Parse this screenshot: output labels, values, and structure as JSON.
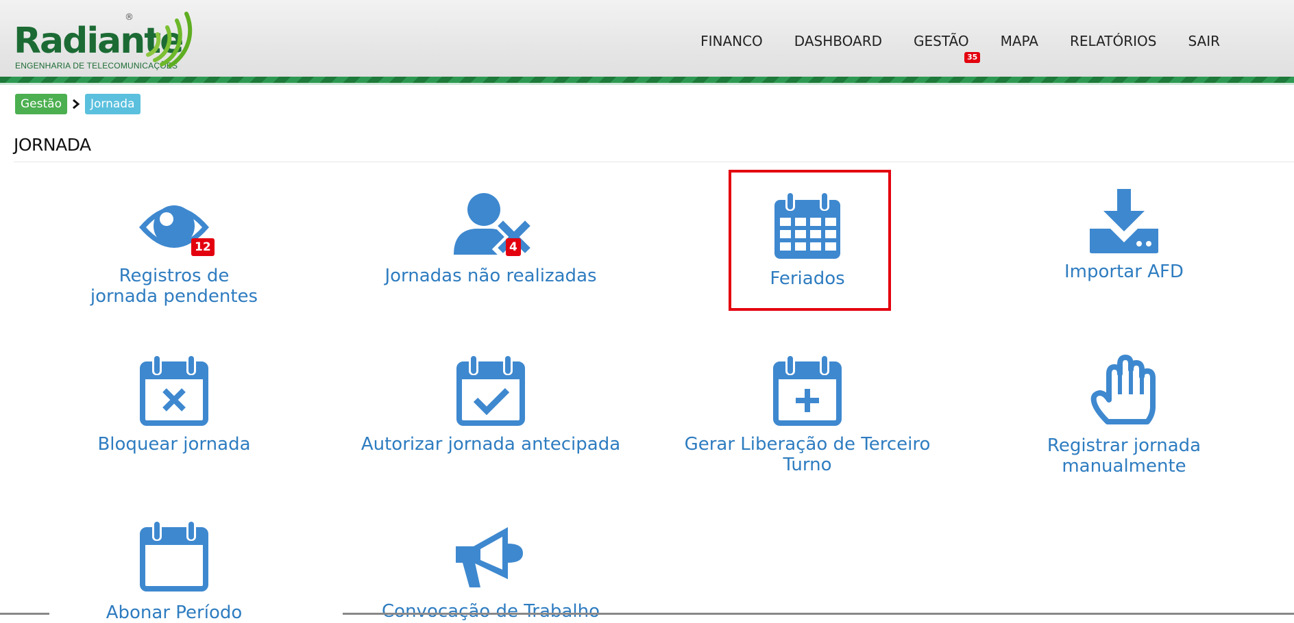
{
  "logo": {
    "name": "Radiante",
    "subtitle": "ENGENHARIA DE TELECOMUNICAÇÕES",
    "registered": "®"
  },
  "nav": {
    "items": [
      {
        "label": "FINANCO"
      },
      {
        "label": "DASHBOARD"
      },
      {
        "label": "GESTÃO",
        "badge": "35"
      },
      {
        "label": "MAPA"
      },
      {
        "label": "RELATÓRIOS"
      },
      {
        "label": "SAIR"
      }
    ]
  },
  "breadcrumb": [
    "Gestão",
    "Jornada"
  ],
  "page": {
    "title": "JORNADA"
  },
  "tiles": [
    {
      "label": "Registros de jornada pendentes",
      "icon": "eye-icon",
      "badge": "12"
    },
    {
      "label": "Jornadas não realizadas",
      "icon": "user-times-icon",
      "badge": "4"
    },
    {
      "label": "Feriados",
      "icon": "calendar-grid-icon",
      "highlighted": true
    },
    {
      "label": "Importar AFD",
      "icon": "download-icon"
    },
    {
      "label": "Bloquear jornada",
      "icon": "calendar-x-icon"
    },
    {
      "label": "Autorizar jornada antecipada",
      "icon": "calendar-check-icon"
    },
    {
      "label": "Gerar Liberação de Terceiro Turno",
      "icon": "calendar-plus-icon"
    },
    {
      "label": "Registrar jornada manualmente",
      "icon": "hand-icon"
    },
    {
      "label": "Abonar Período",
      "icon": "calendar-icon"
    },
    {
      "label": "Convocação de Trabalho",
      "icon": "megaphone-icon"
    }
  ],
  "colors": {
    "brand_green": "#1c6b34",
    "accent_green": "#4caf50",
    "accent_blue": "#5bc0de",
    "icon_blue": "#3e88cf",
    "link_blue": "#2e7cc0",
    "badge_red": "#e3000f",
    "highlight_red": "#e3000f"
  }
}
